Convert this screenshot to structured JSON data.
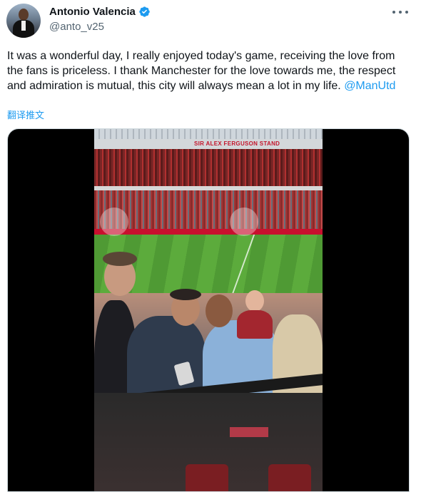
{
  "author": {
    "display_name": "Antonio Valencia",
    "handle": "@anto_v25",
    "avatar_icon": "profile-avatar",
    "verified_icon": "verified-badge-icon"
  },
  "tweet": {
    "text": "It was a wonderful day, I really enjoyed today's game, receiving the love from the fans is priceless. I thank Manchester for the love towards me, the respect and admiration is mutual, this city will always mean a lot in my life.",
    "mention": "@ManUtd",
    "translate_label": "翻译推文"
  },
  "media": {
    "stand_sign": "SIR ALEX FERGUSON STAND"
  },
  "colors": {
    "link": "#1d9bf0",
    "text": "#0f1419",
    "muted": "#536471"
  }
}
